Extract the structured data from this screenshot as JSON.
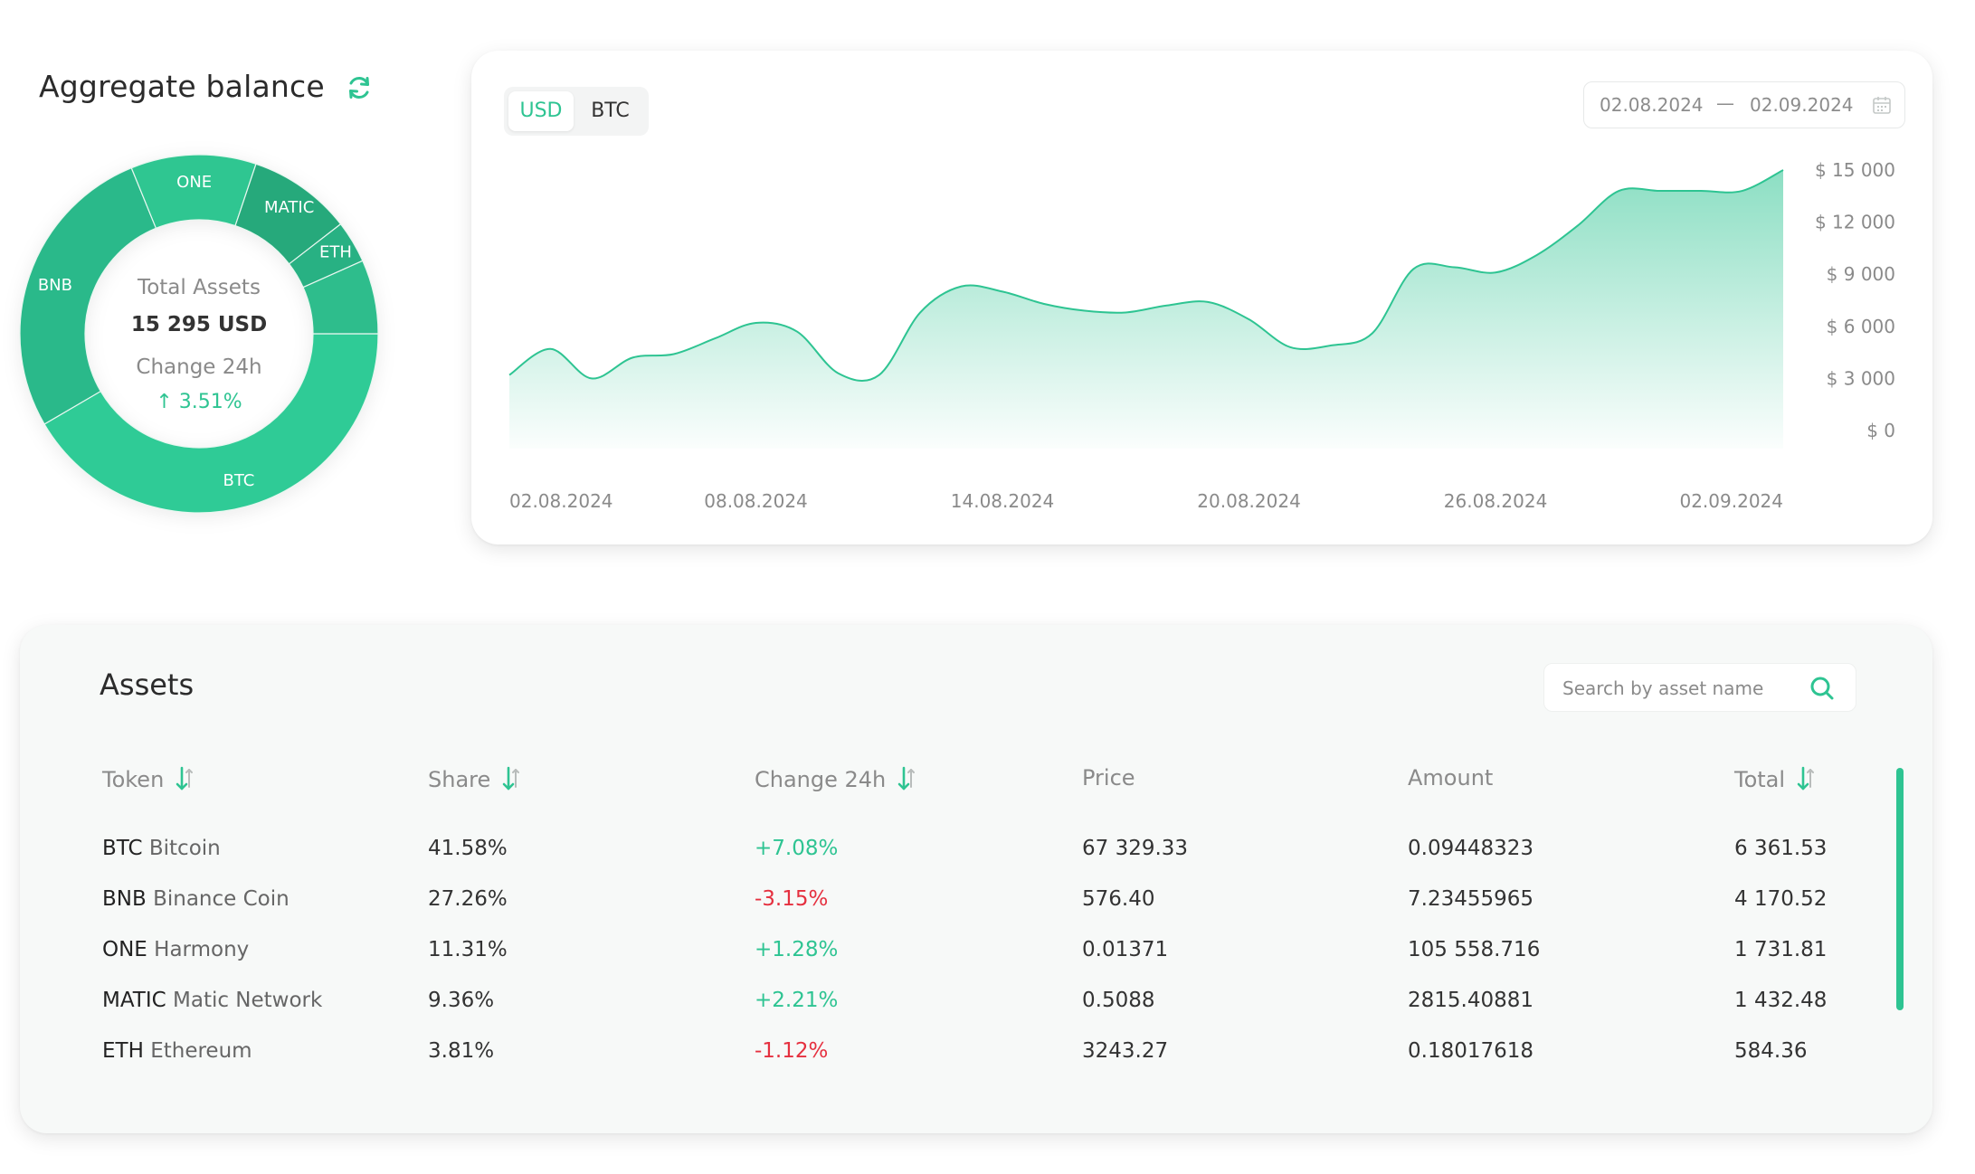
{
  "aggregate": {
    "title": "Aggregate balance",
    "total_label": "Total Assets",
    "total_value": "15 295 USD",
    "change_label": "Change 24h",
    "change_value": "↑ 3.51%",
    "donut": [
      {
        "label": "BTC",
        "share": 41.58,
        "color": "#2fcb96"
      },
      {
        "label": "BNB",
        "share": 27.26,
        "color": "#2ab98a"
      },
      {
        "label": "ONE",
        "share": 11.31,
        "color": "#2fc691"
      },
      {
        "label": "MATIC",
        "share": 9.36,
        "color": "#26a97b"
      },
      {
        "label": "ETH",
        "share": 3.81,
        "color": "#28b183"
      },
      {
        "label": "",
        "share": 6.68,
        "color": "#2ebd8c"
      }
    ]
  },
  "chart": {
    "currency_active": "USD",
    "currency_other": "BTC",
    "date_from": "02.08.2024",
    "date_dash": "—",
    "date_to": "02.09.2024",
    "calendar_icon": "calendar-icon"
  },
  "chart_data": {
    "type": "area",
    "x_ticks": [
      "02.08.2024",
      "08.08.2024",
      "14.08.2024",
      "20.08.2024",
      "26.08.2024",
      "02.09.2024"
    ],
    "y_ticks": [
      "$ 15 000",
      "$ 12 000",
      "$ 9 000",
      "$ 6 000",
      "$ 3 000",
      "$ 0"
    ],
    "ylim": [
      0,
      15000
    ],
    "x": [
      "02.08.2024",
      "03.08.2024",
      "04.08.2024",
      "05.08.2024",
      "06.08.2024",
      "07.08.2024",
      "08.08.2024",
      "09.08.2024",
      "10.08.2024",
      "11.08.2024",
      "12.08.2024",
      "13.08.2024",
      "14.08.2024",
      "15.08.2024",
      "16.08.2024",
      "17.08.2024",
      "18.08.2024",
      "19.08.2024",
      "20.08.2024",
      "21.08.2024",
      "22.08.2024",
      "23.08.2024",
      "24.08.2024",
      "25.08.2024",
      "26.08.2024",
      "27.08.2024",
      "28.08.2024",
      "29.08.2024",
      "30.08.2024",
      "31.08.2024",
      "01.09.2024",
      "02.09.2024"
    ],
    "values": [
      3200,
      4700,
      3000,
      4200,
      4400,
      5300,
      6200,
      5700,
      3300,
      3200,
      6800,
      8300,
      8000,
      7300,
      6900,
      6800,
      7200,
      7400,
      6400,
      4800,
      4900,
      5600,
      9300,
      9400,
      9100,
      10100,
      11800,
      13800,
      13800,
      13800,
      13800,
      15000
    ],
    "line_color": "#2ec492",
    "fill_color": "#2ec492",
    "grid": false
  },
  "assets": {
    "title": "Assets",
    "search_placeholder": "Search by asset name",
    "headers": {
      "token": "Token",
      "share": "Share",
      "change": "Change 24h",
      "price": "Price",
      "amount": "Amount",
      "total": "Total"
    },
    "rows": [
      {
        "symbol": "BTC",
        "name": "Bitcoin",
        "share": "41.58%",
        "change": "+7.08%",
        "direction": "up",
        "price": "67 329.33",
        "amount": "0.09448323",
        "total": "6 361.53"
      },
      {
        "symbol": "BNB",
        "name": "Binance Coin",
        "share": "27.26%",
        "change": "-3.15%",
        "direction": "down",
        "price": "576.40",
        "amount": "7.23455965",
        "total": "4 170.52"
      },
      {
        "symbol": "ONE",
        "name": "Harmony",
        "share": "11.31%",
        "change": "+1.28%",
        "direction": "up",
        "price": "0.01371",
        "amount": "105 558.716",
        "total": "1 731.81"
      },
      {
        "symbol": "MATIC",
        "name": "Matic Network",
        "share": "9.36%",
        "change": "+2.21%",
        "direction": "up",
        "price": "0.5088",
        "amount": "2815.40881",
        "total": "1 432.48"
      },
      {
        "symbol": "ETH",
        "name": "Ethereum",
        "share": "3.81%",
        "change": "-1.12%",
        "direction": "down",
        "price": "3243.27",
        "amount": "0.18017618",
        "total": "584.36"
      }
    ]
  },
  "colors": {
    "accent": "#2ec492",
    "negative": "#e5303f"
  }
}
